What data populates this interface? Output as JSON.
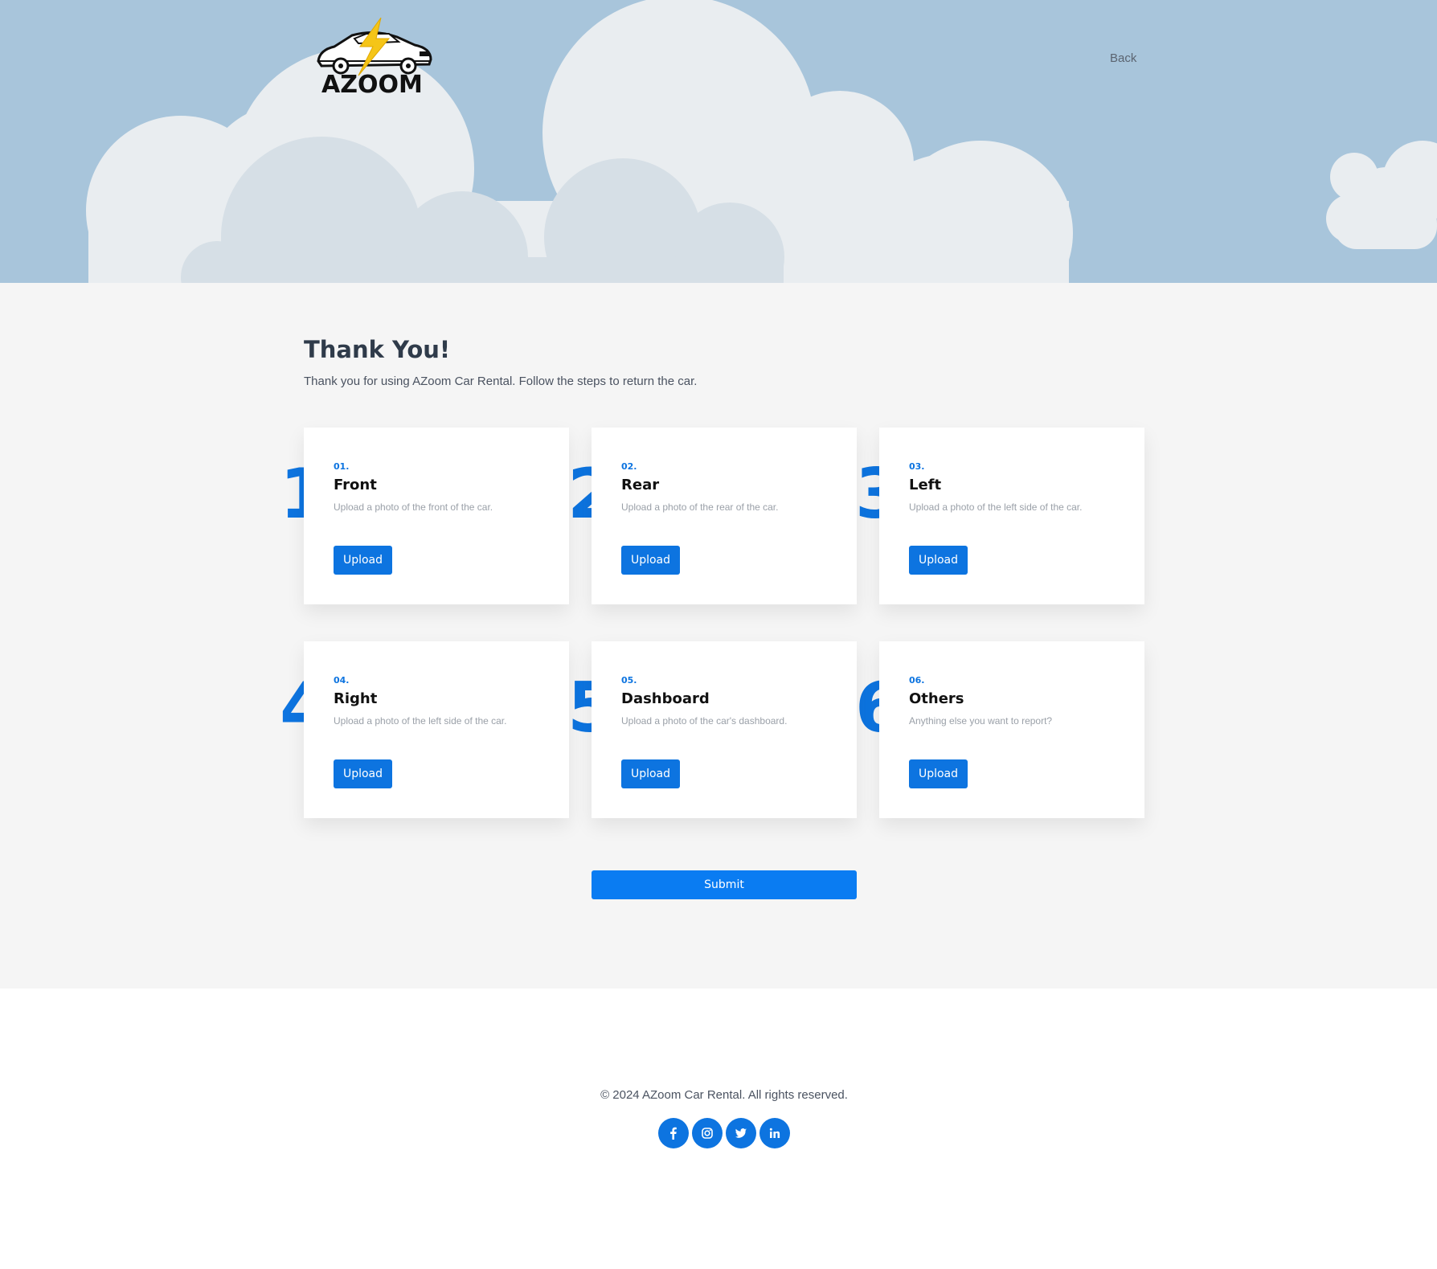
{
  "header": {
    "brand": "AZOOM",
    "back_label": "Back"
  },
  "main": {
    "title": "Thank You!",
    "subtitle": "Thank you for using AZoom Car Rental. Follow the steps to return the car.",
    "steps": [
      {
        "big": "1",
        "number": "01.",
        "title": "Front",
        "description": "Upload a photo of the front of the car.",
        "button": "Upload"
      },
      {
        "big": "2",
        "number": "02.",
        "title": "Rear",
        "description": "Upload a photo of the rear of the car.",
        "button": "Upload"
      },
      {
        "big": "3",
        "number": "03.",
        "title": "Left",
        "description": "Upload a photo of the left side of the car.",
        "button": "Upload"
      },
      {
        "big": "4",
        "number": "04.",
        "title": "Right",
        "description": "Upload a photo of the left side of the car.",
        "button": "Upload"
      },
      {
        "big": "5",
        "number": "05.",
        "title": "Dashboard",
        "description": "Upload a photo of the car's dashboard.",
        "button": "Upload"
      },
      {
        "big": "6",
        "number": "06.",
        "title": "Others",
        "description": "Anything else you want to report?",
        "button": "Upload"
      }
    ],
    "submit_label": "Submit"
  },
  "footer": {
    "copyright": "© 2024 AZoom Car Rental. All rights reserved.",
    "socials": [
      "facebook-icon",
      "instagram-icon",
      "twitter-icon",
      "linkedin-icon"
    ]
  },
  "colors": {
    "accent": "#0d74e0",
    "sky": "#a8c5db",
    "page_bg": "#f5f5f5"
  }
}
